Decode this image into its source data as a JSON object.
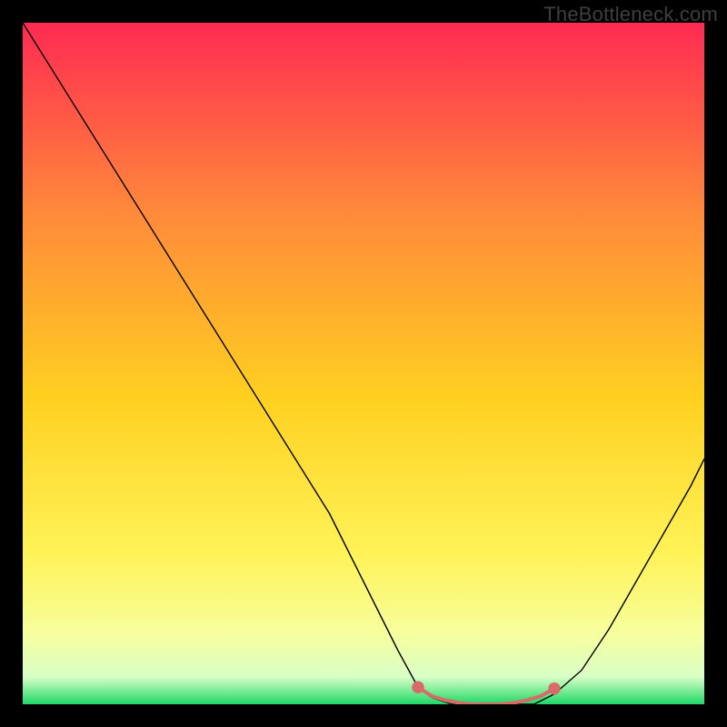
{
  "watermark": "TheBottleneck.com",
  "palette": {
    "bg": "#000000",
    "grad_top": "#ff2a52",
    "grad_upper_mid": "#ff8a3a",
    "grad_mid": "#ffd020",
    "grad_lower_mid": "#fff358",
    "grad_low": "#f6ffa0",
    "grad_base_light": "#d8ffc6",
    "grad_bottom": "#1fd866",
    "curve": "#000000",
    "marker": "#d86a6a"
  },
  "chart_data": {
    "type": "line",
    "title": "",
    "xlabel": "",
    "ylabel": "",
    "xlim": [
      0,
      100
    ],
    "ylim": [
      0,
      100
    ],
    "curve": {
      "name": "bottleneck-curve",
      "x": [
        0,
        5,
        10,
        15,
        20,
        25,
        30,
        35,
        40,
        45,
        50,
        55,
        58,
        60,
        63,
        67,
        72,
        75,
        78,
        82,
        86,
        90,
        94,
        98,
        100
      ],
      "y": [
        100,
        92,
        84,
        76,
        68,
        60,
        52,
        44,
        36,
        28,
        18,
        8,
        2.5,
        1,
        0,
        0,
        0,
        0,
        1.5,
        5,
        11,
        18,
        25,
        32,
        36
      ]
    },
    "markers": {
      "name": "optimal-range",
      "color": "#d86a6a",
      "points": [
        {
          "x": 58,
          "y": 2.5
        },
        {
          "x": 60,
          "y": 1.2
        },
        {
          "x": 62,
          "y": 0.6
        },
        {
          "x": 64,
          "y": 0.2
        },
        {
          "x": 66,
          "y": 0.0
        },
        {
          "x": 68,
          "y": 0.0
        },
        {
          "x": 70,
          "y": 0.0
        },
        {
          "x": 72,
          "y": 0.2
        },
        {
          "x": 74,
          "y": 0.6
        },
        {
          "x": 76,
          "y": 1.2
        },
        {
          "x": 78,
          "y": 2.3
        }
      ]
    }
  }
}
